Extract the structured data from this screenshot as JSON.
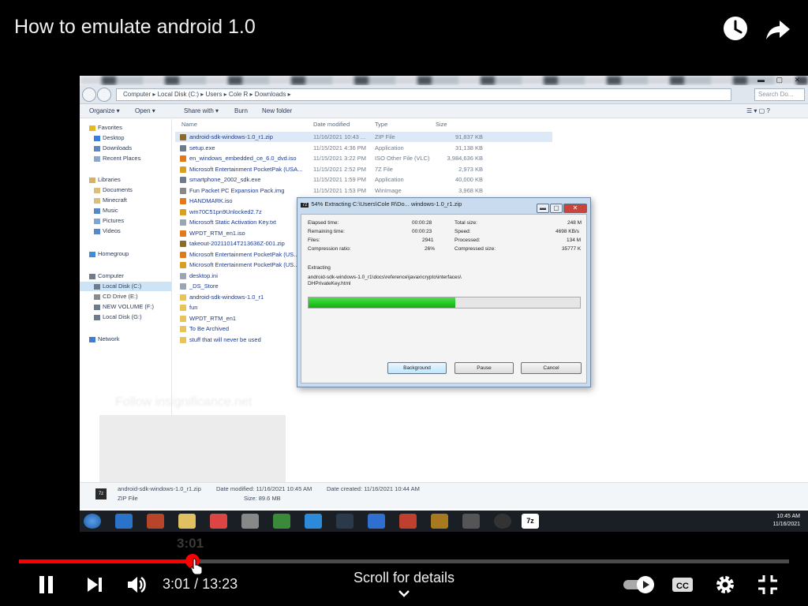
{
  "player": {
    "title": "How to emulate android 1.0",
    "hover_time": "3:01",
    "current_time": "3:01",
    "duration": "13:23",
    "time_separator": "/",
    "played_fraction": 0.225,
    "scroll_hint": "Scroll for details",
    "icons": [
      "watch-later-icon",
      "share-icon",
      "pause-icon",
      "next-icon",
      "volume-icon",
      "autoplay-toggle",
      "cc-icon",
      "settings-icon",
      "exit-fullscreen-icon"
    ],
    "accent_color": "#ff0000"
  },
  "explorer": {
    "breadcrumbs": [
      "Computer",
      "Local Disk (C:)",
      "Users",
      "Cole R",
      "Downloads"
    ],
    "search_placeholder": "Search Do...",
    "toolbar": [
      "Organize ▾",
      "Open ▾",
      "Share with ▾",
      "Burn",
      "New folder"
    ],
    "nav": [
      {
        "label": "Favorites"
      },
      {
        "label": "Desktop"
      },
      {
        "label": "Downloads"
      },
      {
        "label": "Recent Places"
      },
      {
        "label": "Libraries"
      },
      {
        "label": "Documents"
      },
      {
        "label": "Minecraft"
      },
      {
        "label": "Music"
      },
      {
        "label": "Pictures"
      },
      {
        "label": "Videos"
      },
      {
        "label": "Homegroup"
      },
      {
        "label": "Computer"
      },
      {
        "label": "Local Disk (C:)"
      },
      {
        "label": "CD Drive (E:)"
      },
      {
        "label": "NEW VOLUME (F:)"
      },
      {
        "label": "Local Disk (G:)"
      },
      {
        "label": "Network"
      }
    ],
    "columns": [
      "Name",
      "Date modified",
      "Type",
      "Size"
    ],
    "files": [
      {
        "name": "android-sdk-windows-1.0_r1.zip",
        "date": "11/16/2021 10:43 ...",
        "type": "ZIP File",
        "size": "91,837 KB",
        "color": "#8b6b2b"
      },
      {
        "name": "setup.exe",
        "date": "11/15/2021 4:36 PM",
        "type": "Application",
        "size": "31,138 KB",
        "color": "#6c7c8c"
      },
      {
        "name": "en_windows_embedded_ce_6.0_dvd.iso",
        "date": "11/15/2021 3:22 PM",
        "type": "ISO Other File (VLC)",
        "size": "3,984,636 KB",
        "color": "#e07a1a"
      },
      {
        "name": "Microsoft Entertainment PocketPak (USA...",
        "date": "11/15/2021 2:52 PM",
        "type": "7Z File",
        "size": "2,973 KB",
        "color": "#d9a020"
      },
      {
        "name": "smartphone_2002_sdk.exe",
        "date": "11/15/2021 1:59 PM",
        "type": "Application",
        "size": "40,000 KB",
        "color": "#6c7c8c"
      },
      {
        "name": "Fun Packet PC Expansion Pack.img",
        "date": "11/15/2021 1:53 PM",
        "type": "WinImage",
        "size": "3,968 KB",
        "color": "#888888"
      },
      {
        "name": "HANDMARK.iso",
        "date": "",
        "type": "",
        "size": "",
        "color": "#e07a1a"
      },
      {
        "name": "wm70C51pn9Unlocked2.7z",
        "date": "",
        "type": "",
        "size": "",
        "color": "#d9a020"
      },
      {
        "name": "Microsoft Static Activation Key.txt",
        "date": "",
        "type": "",
        "size": "",
        "color": "#9aa6b4"
      },
      {
        "name": "WPDT_RTM_en1.iso",
        "date": "",
        "type": "",
        "size": "",
        "color": "#e07a1a"
      },
      {
        "name": "takeout-20211014T213636Z-001.zip",
        "date": "",
        "type": "",
        "size": "",
        "color": "#8b6b2b"
      },
      {
        "name": "Microsoft Entertainment PocketPak (US...",
        "date": "",
        "type": "",
        "size": "",
        "color": "#e07a1a"
      },
      {
        "name": "Microsoft Entertainment PocketPak (US...",
        "date": "",
        "type": "",
        "size": "",
        "color": "#d9a020"
      },
      {
        "name": "desktop.ini",
        "date": "",
        "type": "",
        "size": "",
        "color": "#9aa6b4"
      },
      {
        "name": "_DS_Store",
        "date": "",
        "type": "",
        "size": "",
        "color": "#9aa6b4"
      },
      {
        "name": "android-sdk-windows-1.0_r1",
        "date": "",
        "type": "",
        "size": "",
        "color": "#e8c35a"
      },
      {
        "name": "fun",
        "date": "",
        "type": "",
        "size": "",
        "color": "#e8c35a"
      },
      {
        "name": "WPDT_RTM_en1",
        "date": "",
        "type": "",
        "size": "",
        "color": "#e8c35a"
      },
      {
        "name": "To Be Archived",
        "date": "",
        "type": "",
        "size": "",
        "color": "#e8c35a"
      },
      {
        "name": "stuff that will never be used",
        "date": "",
        "type": "",
        "size": "",
        "color": "#e8c35a"
      }
    ],
    "watermark": "Follow insignificance.net",
    "details_name": "android-sdk-windows-1.0_r1.zip",
    "details_type": "ZIP File",
    "details_modified": "Date modified: 11/16/2021 10:45 AM",
    "details_created": "Date created: 11/16/2021 10:44 AM",
    "details_size": "Size: 89.6 MB",
    "tray_time": "10:45 AM",
    "tray_date": "11/16/2021"
  },
  "dialog": {
    "badge": "7z",
    "title": "54% Extracting C:\\Users\\Cole R\\Do... windows-1.0_r1.zip",
    "elapsed_label": "Elapsed time:",
    "elapsed": "00:00:28",
    "remaining_label": "Remaining time:",
    "remaining": "00:00:23",
    "files_label": "Files:",
    "files": "2941",
    "ratio_label": "Compression ratio:",
    "ratio": "26%",
    "total_label": "Total size:",
    "total": "248 M",
    "speed_label": "Speed:",
    "speed": "4698 KB/s",
    "processed_label": "Processed:",
    "processed": "134 M",
    "compressed_label": "Compressed size:",
    "compressed": "35777 K",
    "extracting_label": "Extracting",
    "path_line1": "android-sdk-windows-1.0_r1\\docs\\reference\\javax\\crypto\\interfaces\\",
    "path_line2": "DHPrivateKey.html",
    "progress_fraction": 0.54,
    "btn_background": "Background",
    "btn_pause": "Pause",
    "btn_cancel": "Cancel"
  }
}
